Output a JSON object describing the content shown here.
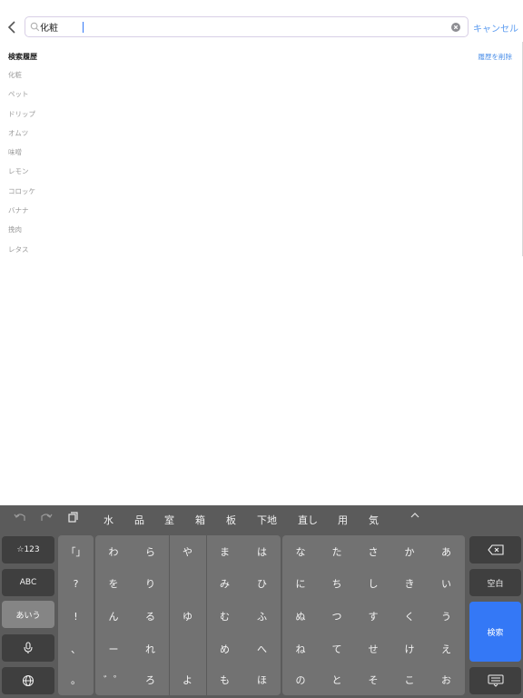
{
  "search": {
    "query": "化粧",
    "cancel_label": "キャンセル"
  },
  "history": {
    "title": "検索履歴",
    "clear_label": "履歴を削除",
    "items": [
      "化粧",
      "ペット",
      "ドリップ",
      "オムツ",
      "味噌",
      "レモン",
      "コロッケ",
      "バナナ",
      "挽肉",
      "レタス"
    ]
  },
  "keyboard": {
    "candidates": [
      "水",
      "品",
      "室",
      "箱",
      "板",
      "下地",
      "直し",
      "用",
      "気"
    ],
    "left_keys": {
      "numbers": "☆123",
      "abc": "ABC",
      "hiragana": "あいう"
    },
    "right_keys": {
      "space": "空白",
      "search": "検索"
    },
    "kana_rows": [
      [
        "「」",
        "わ",
        "ら",
        "や",
        "ま",
        "は",
        "な",
        "た",
        "さ",
        "か",
        "あ"
      ],
      [
        "?",
        "を",
        "り",
        "",
        "み",
        "ひ",
        "に",
        "ち",
        "し",
        "き",
        "い"
      ],
      [
        "!",
        "ん",
        "る",
        "ゆ",
        "む",
        "ふ",
        "ぬ",
        "つ",
        "す",
        "く",
        "う"
      ],
      [
        "、",
        "ー",
        "れ",
        "",
        "め",
        "へ",
        "ね",
        "て",
        "せ",
        "け",
        "え"
      ],
      [
        "。",
        "゛゜",
        "ろ",
        "よ",
        "も",
        "ほ",
        "の",
        "と",
        "そ",
        "こ",
        "お"
      ]
    ]
  }
}
